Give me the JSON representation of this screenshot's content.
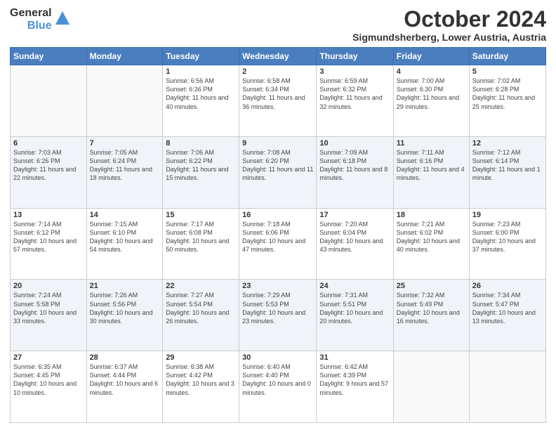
{
  "header": {
    "logo": {
      "line1": "General",
      "line2": "Blue"
    },
    "month": "October 2024",
    "location": "Sigmundsherberg, Lower Austria, Austria"
  },
  "days_of_week": [
    "Sunday",
    "Monday",
    "Tuesday",
    "Wednesday",
    "Thursday",
    "Friday",
    "Saturday"
  ],
  "weeks": [
    [
      {
        "day": "",
        "sunrise": "",
        "sunset": "",
        "daylight": ""
      },
      {
        "day": "",
        "sunrise": "",
        "sunset": "",
        "daylight": ""
      },
      {
        "day": "1",
        "sunrise": "Sunrise: 6:56 AM",
        "sunset": "Sunset: 6:36 PM",
        "daylight": "Daylight: 11 hours and 40 minutes."
      },
      {
        "day": "2",
        "sunrise": "Sunrise: 6:58 AM",
        "sunset": "Sunset: 6:34 PM",
        "daylight": "Daylight: 11 hours and 36 minutes."
      },
      {
        "day": "3",
        "sunrise": "Sunrise: 6:59 AM",
        "sunset": "Sunset: 6:32 PM",
        "daylight": "Daylight: 11 hours and 32 minutes."
      },
      {
        "day": "4",
        "sunrise": "Sunrise: 7:00 AM",
        "sunset": "Sunset: 6:30 PM",
        "daylight": "Daylight: 11 hours and 29 minutes."
      },
      {
        "day": "5",
        "sunrise": "Sunrise: 7:02 AM",
        "sunset": "Sunset: 6:28 PM",
        "daylight": "Daylight: 11 hours and 25 minutes."
      }
    ],
    [
      {
        "day": "6",
        "sunrise": "Sunrise: 7:03 AM",
        "sunset": "Sunset: 6:26 PM",
        "daylight": "Daylight: 11 hours and 22 minutes."
      },
      {
        "day": "7",
        "sunrise": "Sunrise: 7:05 AM",
        "sunset": "Sunset: 6:24 PM",
        "daylight": "Daylight: 11 hours and 18 minutes."
      },
      {
        "day": "8",
        "sunrise": "Sunrise: 7:06 AM",
        "sunset": "Sunset: 6:22 PM",
        "daylight": "Daylight: 11 hours and 15 minutes."
      },
      {
        "day": "9",
        "sunrise": "Sunrise: 7:08 AM",
        "sunset": "Sunset: 6:20 PM",
        "daylight": "Daylight: 11 hours and 11 minutes."
      },
      {
        "day": "10",
        "sunrise": "Sunrise: 7:09 AM",
        "sunset": "Sunset: 6:18 PM",
        "daylight": "Daylight: 11 hours and 8 minutes."
      },
      {
        "day": "11",
        "sunrise": "Sunrise: 7:11 AM",
        "sunset": "Sunset: 6:16 PM",
        "daylight": "Daylight: 11 hours and 4 minutes."
      },
      {
        "day": "12",
        "sunrise": "Sunrise: 7:12 AM",
        "sunset": "Sunset: 6:14 PM",
        "daylight": "Daylight: 11 hours and 1 minute."
      }
    ],
    [
      {
        "day": "13",
        "sunrise": "Sunrise: 7:14 AM",
        "sunset": "Sunset: 6:12 PM",
        "daylight": "Daylight: 10 hours and 57 minutes."
      },
      {
        "day": "14",
        "sunrise": "Sunrise: 7:15 AM",
        "sunset": "Sunset: 6:10 PM",
        "daylight": "Daylight: 10 hours and 54 minutes."
      },
      {
        "day": "15",
        "sunrise": "Sunrise: 7:17 AM",
        "sunset": "Sunset: 6:08 PM",
        "daylight": "Daylight: 10 hours and 50 minutes."
      },
      {
        "day": "16",
        "sunrise": "Sunrise: 7:18 AM",
        "sunset": "Sunset: 6:06 PM",
        "daylight": "Daylight: 10 hours and 47 minutes."
      },
      {
        "day": "17",
        "sunrise": "Sunrise: 7:20 AM",
        "sunset": "Sunset: 6:04 PM",
        "daylight": "Daylight: 10 hours and 43 minutes."
      },
      {
        "day": "18",
        "sunrise": "Sunrise: 7:21 AM",
        "sunset": "Sunset: 6:02 PM",
        "daylight": "Daylight: 10 hours and 40 minutes."
      },
      {
        "day": "19",
        "sunrise": "Sunrise: 7:23 AM",
        "sunset": "Sunset: 6:00 PM",
        "daylight": "Daylight: 10 hours and 37 minutes."
      }
    ],
    [
      {
        "day": "20",
        "sunrise": "Sunrise: 7:24 AM",
        "sunset": "Sunset: 5:58 PM",
        "daylight": "Daylight: 10 hours and 33 minutes."
      },
      {
        "day": "21",
        "sunrise": "Sunrise: 7:26 AM",
        "sunset": "Sunset: 5:56 PM",
        "daylight": "Daylight: 10 hours and 30 minutes."
      },
      {
        "day": "22",
        "sunrise": "Sunrise: 7:27 AM",
        "sunset": "Sunset: 5:54 PM",
        "daylight": "Daylight: 10 hours and 26 minutes."
      },
      {
        "day": "23",
        "sunrise": "Sunrise: 7:29 AM",
        "sunset": "Sunset: 5:53 PM",
        "daylight": "Daylight: 10 hours and 23 minutes."
      },
      {
        "day": "24",
        "sunrise": "Sunrise: 7:31 AM",
        "sunset": "Sunset: 5:51 PM",
        "daylight": "Daylight: 10 hours and 20 minutes."
      },
      {
        "day": "25",
        "sunrise": "Sunrise: 7:32 AM",
        "sunset": "Sunset: 5:49 PM",
        "daylight": "Daylight: 10 hours and 16 minutes."
      },
      {
        "day": "26",
        "sunrise": "Sunrise: 7:34 AM",
        "sunset": "Sunset: 5:47 PM",
        "daylight": "Daylight: 10 hours and 13 minutes."
      }
    ],
    [
      {
        "day": "27",
        "sunrise": "Sunrise: 6:35 AM",
        "sunset": "Sunset: 4:45 PM",
        "daylight": "Daylight: 10 hours and 10 minutes."
      },
      {
        "day": "28",
        "sunrise": "Sunrise: 6:37 AM",
        "sunset": "Sunset: 4:44 PM",
        "daylight": "Daylight: 10 hours and 6 minutes."
      },
      {
        "day": "29",
        "sunrise": "Sunrise: 6:38 AM",
        "sunset": "Sunset: 4:42 PM",
        "daylight": "Daylight: 10 hours and 3 minutes."
      },
      {
        "day": "30",
        "sunrise": "Sunrise: 6:40 AM",
        "sunset": "Sunset: 4:40 PM",
        "daylight": "Daylight: 10 hours and 0 minutes."
      },
      {
        "day": "31",
        "sunrise": "Sunrise: 6:42 AM",
        "sunset": "Sunset: 4:39 PM",
        "daylight": "Daylight: 9 hours and 57 minutes."
      },
      {
        "day": "",
        "sunrise": "",
        "sunset": "",
        "daylight": ""
      },
      {
        "day": "",
        "sunrise": "",
        "sunset": "",
        "daylight": ""
      }
    ]
  ]
}
